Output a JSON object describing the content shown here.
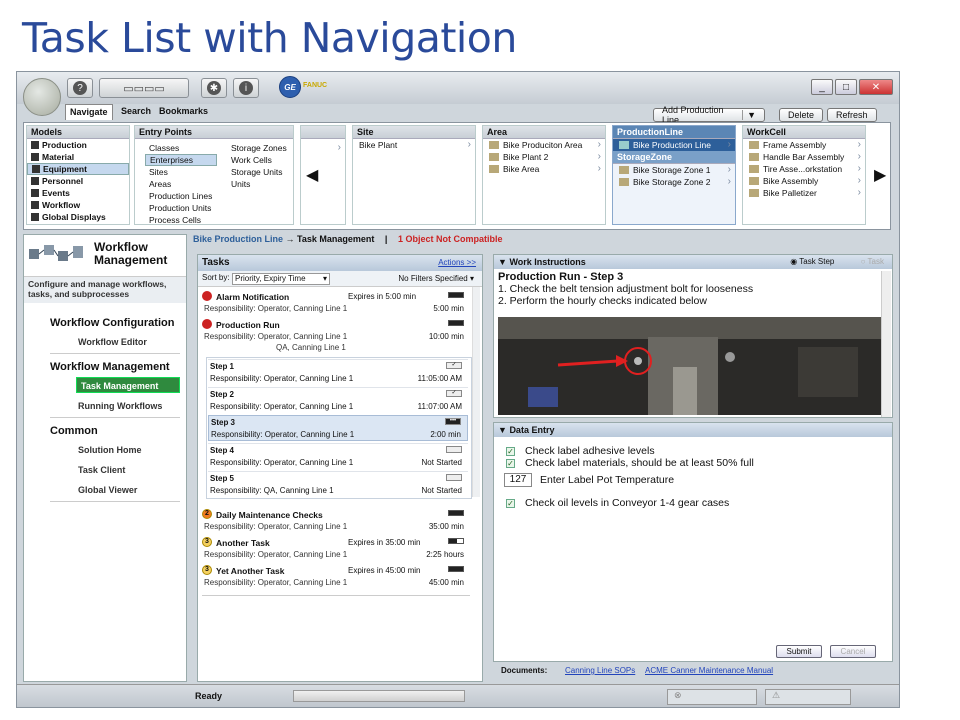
{
  "slide_title": "Task List with Navigation",
  "header": {
    "logo_text": "GE",
    "brand_text": "FANUC"
  },
  "nav_tabs": [
    "Navigate",
    "Search",
    "Bookmarks"
  ],
  "toolbar": {
    "add_production_line": "Add Production Line",
    "delete": "Delete",
    "refresh": "Refresh"
  },
  "models": {
    "title": "Models",
    "items": [
      "Production",
      "Material",
      "Equipment",
      "Personnel",
      "Events",
      "Workflow",
      "Global Displays"
    ],
    "selected": "Equipment"
  },
  "entry_points": {
    "title": "Entry Points",
    "col1": [
      "Classes",
      "Enterprises",
      "Sites",
      "Areas",
      "Production Lines",
      "Production Units",
      "Process Cells"
    ],
    "col2": [
      "Storage Zones",
      "Work Cells",
      "Storage Units",
      "Units"
    ],
    "selected": "Enterprises"
  },
  "site": {
    "title": "Site",
    "items": [
      "Bike Plant"
    ]
  },
  "area": {
    "title": "Area",
    "items": [
      "Bike Produciton Area",
      "Bike Plant 2",
      "Bike Area"
    ]
  },
  "production_line": {
    "title": "ProductionLine",
    "items": [
      "Bike Production Line"
    ],
    "storage_title": "StorageZone",
    "storage_items": [
      "Bike Storage Zone 1",
      "Bike Storage Zone  2"
    ]
  },
  "workcell": {
    "title": "WorkCell",
    "items": [
      "Frame Assembly",
      "Handle Bar Assembly",
      "Tire Asse...orkstation",
      "Bike Assembly",
      "Bike Palletizer"
    ]
  },
  "sidebar": {
    "title": "Workflow Management",
    "description": "Configure and manage workflows, tasks, and subprocesses",
    "sections": [
      {
        "title": "Workflow Configuration",
        "items": [
          "Workflow Editor"
        ]
      },
      {
        "title": "Workflow Management",
        "items": [
          "Task Management",
          "Running Workflows"
        ]
      },
      {
        "title": "Common",
        "items": [
          "Solution Home",
          "Task Client",
          "Global Viewer"
        ]
      }
    ],
    "active_item": "Task Management"
  },
  "breadcrumb": {
    "parent": "Bike Production Line",
    "arrow": "→",
    "current": "Task Management",
    "separator": "|",
    "warning": "1 Object Not Compatible"
  },
  "tasks_panel": {
    "title": "Tasks",
    "actions": "Actions >>",
    "sort_label": "Sort by:",
    "sort_value": "Priority, Expiry Time",
    "filters": "No Filters Specified",
    "tasks": [
      {
        "name": "Alarm Notification",
        "expires": "Expires in 5:00 min",
        "responsibility": "Responsibility:  Operator, Canning Line 1",
        "time": "5:00 min",
        "icon": "red"
      },
      {
        "name": "Production Run",
        "expires": "",
        "responsibility": "Responsibility:  Operator, Canning Line 1",
        "responsibility2": "QA, Canning Line 1",
        "time": "10:00 min",
        "icon": "red"
      },
      {
        "name": "Daily Maintenance Checks",
        "expires": "",
        "responsibility": "Responsibility:  Operator, Canning Line 1",
        "time": "35:00 min",
        "icon": "2"
      },
      {
        "name": "Another Task",
        "expires": "Expires in 35:00 min",
        "responsibility": "Responsibility:  Operator, Canning Line 1",
        "time": "2:25 hours",
        "icon": "3"
      },
      {
        "name": "Yet Another Task",
        "expires": "Expires in 45:00 min",
        "responsibility": "Responsibility:  Operator, Canning Line 1",
        "time": "45:00 min",
        "icon": "3"
      }
    ],
    "steps": [
      {
        "name": "Step 1",
        "responsibility": "Responsibility:  Operator, Canning Line 1",
        "time": "11:05:00 AM"
      },
      {
        "name": "Step 2",
        "responsibility": "Responsibility:  Operator, Canning Line 1",
        "time": "11:07:00 AM"
      },
      {
        "name": "Step 3",
        "responsibility": "Responsibility:  Operator, Canning Line 1",
        "time": "2:00 min"
      },
      {
        "name": "Step 4",
        "responsibility": "Responsibility:  Operator, Canning Line 1",
        "time": "Not Started"
      },
      {
        "name": "Step 5",
        "responsibility": "Responsibility:  QA, Canning Line 1",
        "time": "Not Started"
      }
    ]
  },
  "work_instructions": {
    "title": "Work Instructions",
    "radio_task_step": "Task Step",
    "radio_task": "Task",
    "heading": "Production Run - Step 3",
    "steps": [
      "1.  Check the belt tension adjustment bolt for looseness",
      "2.  Perform the hourly checks indicated below"
    ]
  },
  "data_entry": {
    "title": "Data Entry",
    "check1": "Check label adhesive levels",
    "check2": "Check label materials, should be at least 50% full",
    "temp_value": "127",
    "temp_label": "Enter Label Pot Temperature",
    "check3": "Check oil levels in Conveyor 1-4 gear cases",
    "submit": "Submit",
    "cancel": "Cancel"
  },
  "documents": {
    "label": "Documents:",
    "link1": "Canning Line SOPs",
    "link2": "ACME Canner Maintenance Manual"
  },
  "status": {
    "ready": "Ready"
  },
  "colors": {
    "title_blue": "#2a4a9a",
    "selection_blue": "#2d5f9a",
    "active_green": "#2f8a3e",
    "alert_red": "#cc2222"
  }
}
